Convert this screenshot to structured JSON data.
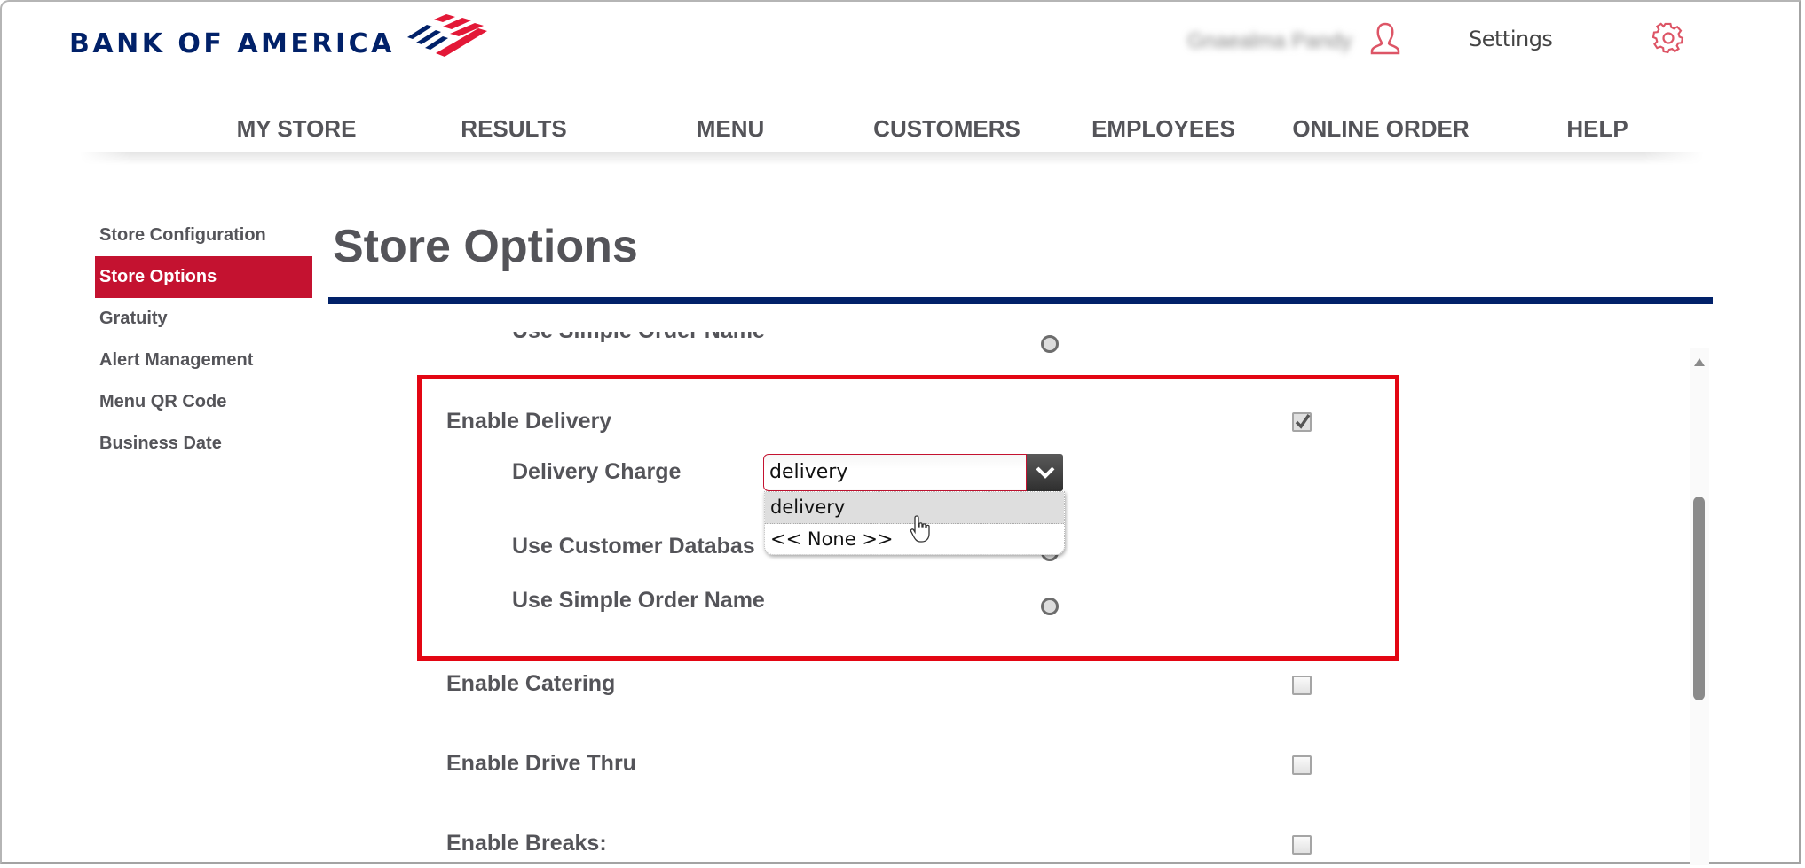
{
  "brand": {
    "name": "BANK OF AMERICA",
    "colors": {
      "navy": "#012169",
      "red": "#e31837",
      "active": "#c41230",
      "highlight": "#e30613"
    }
  },
  "header": {
    "user_name": "Gnaealma Pandy",
    "settings_label": "Settings",
    "icons": {
      "user": "user-icon",
      "settings": "gear-icon"
    }
  },
  "nav": {
    "items": [
      {
        "label": "MY STORE"
      },
      {
        "label": "RESULTS"
      },
      {
        "label": "MENU"
      },
      {
        "label": "CUSTOMERS"
      },
      {
        "label": "EMPLOYEES"
      },
      {
        "label": "ONLINE ORDER"
      },
      {
        "label": "HELP"
      }
    ]
  },
  "sidebar": {
    "items": [
      {
        "label": "Store Configuration",
        "active": false
      },
      {
        "label": "Store Options",
        "active": true
      },
      {
        "label": "Gratuity",
        "active": false
      },
      {
        "label": "Alert Management",
        "active": false
      },
      {
        "label": "Menu QR Code",
        "active": false
      },
      {
        "label": "Business Date",
        "active": false
      }
    ]
  },
  "main": {
    "title": "Store Options",
    "options": {
      "clipped_top": {
        "label": "Use Simple Order Name",
        "type": "radio",
        "checked": false
      },
      "enable_delivery": {
        "label": "Enable Delivery",
        "type": "checkbox",
        "checked": true
      },
      "delivery_charge": {
        "label": "Delivery Charge",
        "value": "delivery",
        "dropdown_open": true,
        "options": [
          "delivery",
          "<< None >>"
        ],
        "hovered_option": "delivery"
      },
      "use_customer_database": {
        "label": "Use Customer Databas",
        "type": "radio",
        "checked": false
      },
      "use_simple_order_name": {
        "label": "Use Simple Order Name",
        "type": "radio",
        "checked": false
      },
      "enable_catering": {
        "label": "Enable Catering",
        "type": "checkbox",
        "checked": false
      },
      "enable_drive_thru": {
        "label": "Enable Drive Thru",
        "type": "checkbox",
        "checked": false
      },
      "enable_breaks": {
        "label": "Enable Breaks:",
        "type": "checkbox",
        "checked": false
      }
    }
  }
}
